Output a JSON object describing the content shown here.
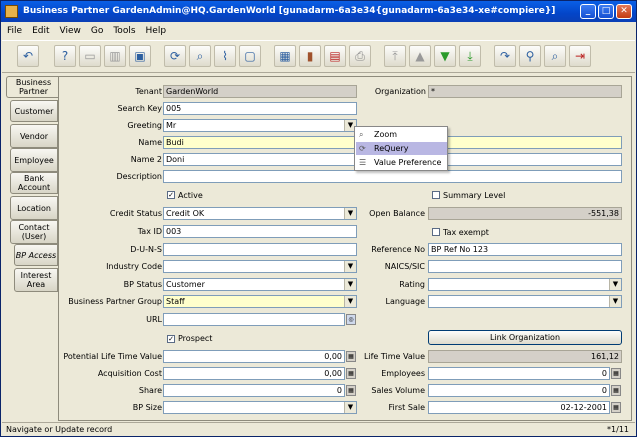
{
  "window": {
    "title": "Business Partner  GardenAdmin@HQ.GardenWorld [gunadarm-6a3e34{gunadarm-6a3e34-xe#compiere}]"
  },
  "menu": [
    "File",
    "Edit",
    "View",
    "Go",
    "Tools",
    "Help"
  ],
  "tabs": [
    {
      "label": "Business Partner"
    },
    {
      "label": "Customer"
    },
    {
      "label": "Vendor"
    },
    {
      "label": "Employee"
    },
    {
      "label": "Bank Account"
    },
    {
      "label": "Location"
    },
    {
      "label": "Contact (User)"
    },
    {
      "label": "BP Access"
    },
    {
      "label": "Interest Area"
    }
  ],
  "form": {
    "tenant": {
      "label": "Tenant",
      "value": "GardenWorld"
    },
    "organization": {
      "label": "Organization",
      "value": "*"
    },
    "search_key": {
      "label": "Search Key",
      "value": "005"
    },
    "greeting": {
      "label": "Greeting",
      "value": "Mr"
    },
    "name": {
      "label": "Name",
      "value": "Budi"
    },
    "name2": {
      "label": "Name 2",
      "value": "Doni"
    },
    "description": {
      "label": "Description",
      "value": ""
    },
    "active": {
      "label": "Active",
      "checked": true
    },
    "summary_level": {
      "label": "Summary Level",
      "checked": false
    },
    "credit_status": {
      "label": "Credit Status",
      "value": "Credit OK"
    },
    "open_balance": {
      "label": "Open Balance",
      "value": "-551,38"
    },
    "tax_id": {
      "label": "Tax ID",
      "value": "003"
    },
    "tax_exempt": {
      "label": "Tax exempt",
      "checked": false
    },
    "duns": {
      "label": "D-U-N-S",
      "value": ""
    },
    "reference_no": {
      "label": "Reference No",
      "value": "BP Ref No 123"
    },
    "industry_code": {
      "label": "Industry Code",
      "value": ""
    },
    "naics": {
      "label": "NAICS/SIC",
      "value": ""
    },
    "bp_status": {
      "label": "BP Status",
      "value": "Customer"
    },
    "rating": {
      "label": "Rating",
      "value": ""
    },
    "bp_group": {
      "label": "Business Partner Group",
      "value": "Staff"
    },
    "language": {
      "label": "Language",
      "value": ""
    },
    "url": {
      "label": "URL",
      "value": ""
    },
    "prospect": {
      "label": "Prospect",
      "checked": true
    },
    "link_org": {
      "label": "Link Organization"
    },
    "potential_ltv": {
      "label": "Potential Life Time Value",
      "value": "0,00"
    },
    "ltv": {
      "label": "Life Time Value",
      "value": "161,12"
    },
    "acq_cost": {
      "label": "Acquisition Cost",
      "value": "0,00"
    },
    "employees": {
      "label": "Employees",
      "value": "0"
    },
    "share": {
      "label": "Share",
      "value": "0"
    },
    "sales_volume": {
      "label": "Sales Volume",
      "value": "0"
    },
    "bp_size": {
      "label": "BP Size",
      "value": ""
    },
    "first_sale": {
      "label": "First Sale",
      "value": "02-12-2001"
    }
  },
  "popup": {
    "items": [
      "Zoom",
      "ReQuery",
      "Value Preference"
    ]
  },
  "status": {
    "message": "Navigate or Update record",
    "record": "*1/11"
  }
}
